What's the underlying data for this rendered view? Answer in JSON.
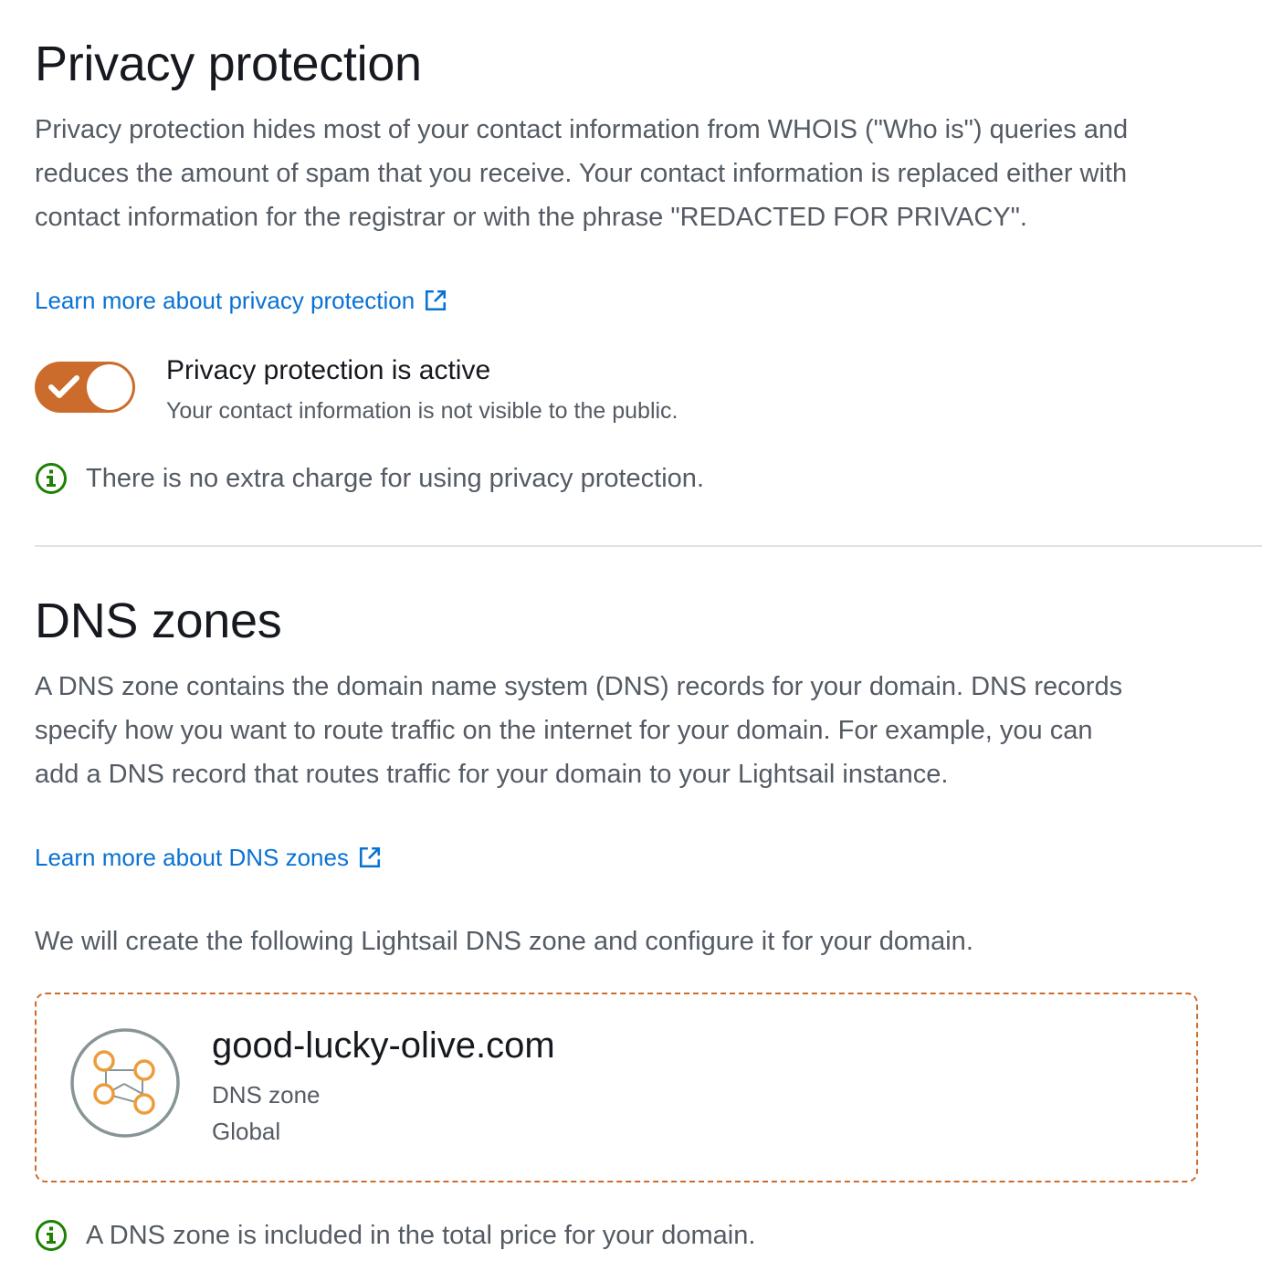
{
  "privacy": {
    "title": "Privacy protection",
    "description": "Privacy protection hides most of your contact information from WHOIS (\"Who is\") queries and reduces the amount of spam that you receive. Your contact information is replaced either with contact information for the registrar or with the phrase \"REDACTED FOR PRIVACY\".",
    "learn_more": "Learn more about privacy protection",
    "toggle": {
      "state": "on",
      "label": "Privacy protection is active",
      "sublabel": "Your contact information is not visible to the public."
    },
    "info": "There is no extra charge for using privacy protection."
  },
  "dns": {
    "title": "DNS zones",
    "description": "A DNS zone contains the domain name system (DNS) records for your domain. DNS records specify how you want to route traffic on the internet for your domain. For example, you can add a DNS record that routes traffic for your domain to your Lightsail instance.",
    "learn_more": "Learn more about DNS zones",
    "create_note": "We will create the following Lightsail DNS zone and configure it for your domain.",
    "zone": {
      "name": "good-lucky-olive.com",
      "type": "DNS zone",
      "region": "Global",
      "icon": "dns-zone-icon"
    },
    "info": "A DNS zone is included in the total price for your domain."
  },
  "colors": {
    "accent": "#cc6c2c",
    "link": "#0972d3",
    "info": "#1d8102",
    "muted_text": "#545b64"
  }
}
